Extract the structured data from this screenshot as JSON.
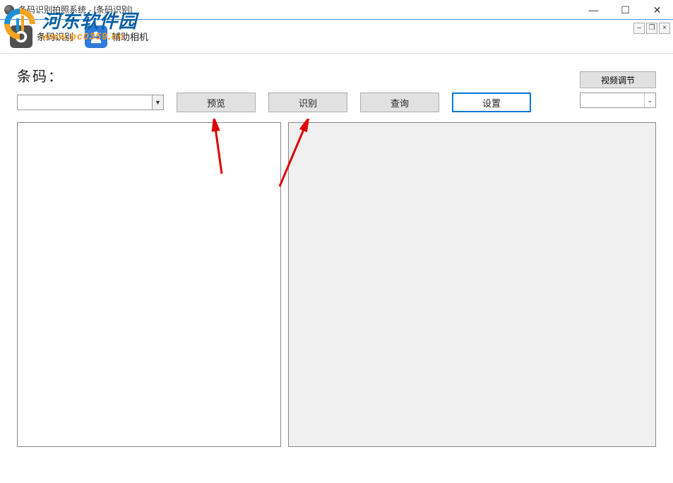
{
  "window": {
    "title": "条码识别拍照系统 - [条码识别]",
    "minimize": "—",
    "maximize": "☐",
    "close": "✕"
  },
  "mdi": {
    "min": "–",
    "restore": "❐",
    "close": "×"
  },
  "watermark": {
    "site_name": "河东软件园",
    "url": "www.pc0359.cn"
  },
  "toolbar": {
    "barcode_label": "条码识别",
    "camera_label": "辅助相机"
  },
  "main": {
    "barcode_label": "条码：",
    "combo_value": "",
    "buttons": {
      "preview": "预览",
      "recognize": "识别",
      "query": "查询",
      "settings": "设置"
    },
    "video_adjust": "视频调节",
    "camera_select_value": ""
  }
}
